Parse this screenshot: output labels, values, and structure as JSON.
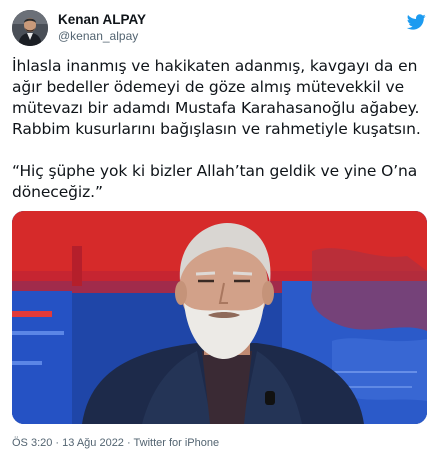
{
  "author": {
    "display_name": "Kenan ALPAY",
    "handle": "@kenan_alpay"
  },
  "tweet": {
    "paragraph_1": "İhlasla inanmış ve hakikaten adanmış, kavgayı da en ağır bedeller ödemeyi de göze almış mütevekkil ve mütevazı bir adamdı Mustafa Karahasanoğlu ağabey. Rabbim kusurlarını bağışlasın ve rahmetiyle kuşatsın.",
    "paragraph_2": "“Hiç şüphe yok ki bizler Allah’tan geldik ve yine O’na döneceğiz.”"
  },
  "meta": {
    "time": "ÖS 3:20",
    "separator_1": " · ",
    "date": "13 Ağu 2022",
    "separator_2": " · ",
    "source": "Twitter for iPhone"
  },
  "colors": {
    "text": "#0f1419",
    "secondary": "#536471",
    "twitter_blue": "#1d9bf0",
    "media_red": "#d62a2a",
    "media_blue": "#1f46a8"
  },
  "icons": {
    "logo": "twitter-bird-icon"
  }
}
